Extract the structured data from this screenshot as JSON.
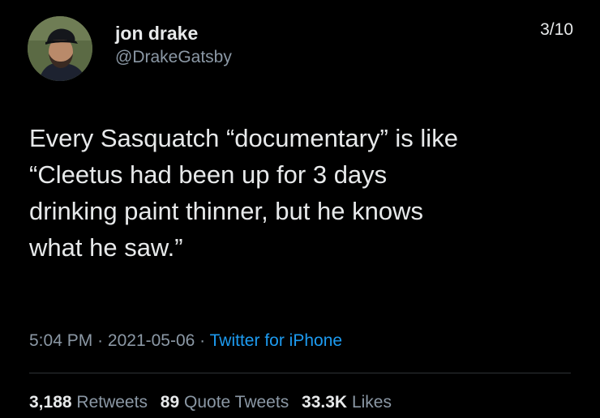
{
  "author": {
    "display_name": "jon drake",
    "handle": "@DrakeGatsby"
  },
  "thread_position": "3/10",
  "tweet_text": "Every Sasquatch “documentary” is like\n“Cleetus had been up for 3 days\ndrinking paint thinner, but he knows\nwhat he saw.”",
  "meta": {
    "time": "5:04 PM",
    "separator": "·",
    "date": "2021-05-06",
    "source": "Twitter for iPhone"
  },
  "stats": {
    "retweets_count": "3,188",
    "retweets_label": "Retweets",
    "quote_tweets_count": "89",
    "quote_tweets_label": "Quote Tweets",
    "likes_count": "33.3K",
    "likes_label": "Likes"
  },
  "colors": {
    "background": "#000000",
    "primary_text": "#e7e9ea",
    "secondary_text": "#8b98a5",
    "link": "#1d9bf0"
  }
}
